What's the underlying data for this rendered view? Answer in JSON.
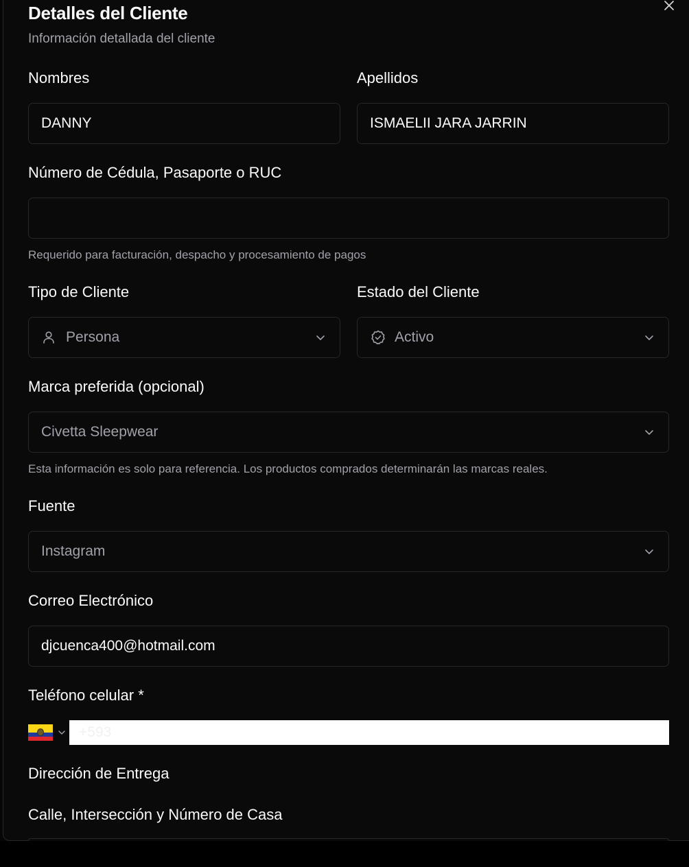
{
  "dialog": {
    "title": "Detalles del Cliente",
    "subtitle": "Información detallada del cliente"
  },
  "fields": {
    "nombres": {
      "label": "Nombres",
      "value": "DANNY"
    },
    "apellidos": {
      "label": "Apellidos",
      "value": "ISMAELII JARA JARRIN"
    },
    "cedula": {
      "label": "Número de Cédula, Pasaporte o RUC",
      "value": "",
      "hint": "Requerido para facturación, despacho y procesamiento de pagos"
    },
    "tipo_cliente": {
      "label": "Tipo de Cliente",
      "selected": "Persona",
      "icon": "user-icon"
    },
    "estado_cliente": {
      "label": "Estado del Cliente",
      "selected": "Activo",
      "icon": "check-badge-icon"
    },
    "marca_preferida": {
      "label": "Marca preferida (opcional)",
      "selected": "Civetta Sleepwear",
      "hint": "Esta información es solo para referencia. Los productos comprados determinarán las marcas reales."
    },
    "fuente": {
      "label": "Fuente",
      "selected": "Instagram"
    },
    "correo": {
      "label": "Correo Electrónico",
      "value": "djcuenca400@hotmail.com"
    },
    "telefono": {
      "label": "Teléfono celular *",
      "country": "ecuador-flag-icon",
      "placeholder": "+593",
      "value": ""
    }
  },
  "direccion": {
    "section_title": "Dirección de Entrega",
    "calle_label": "Calle, Intersección y Número de Casa"
  },
  "colors": {
    "background": "#0a0a0b",
    "border": "#27272a",
    "text": "#fafafa",
    "muted": "#a1a1aa"
  }
}
